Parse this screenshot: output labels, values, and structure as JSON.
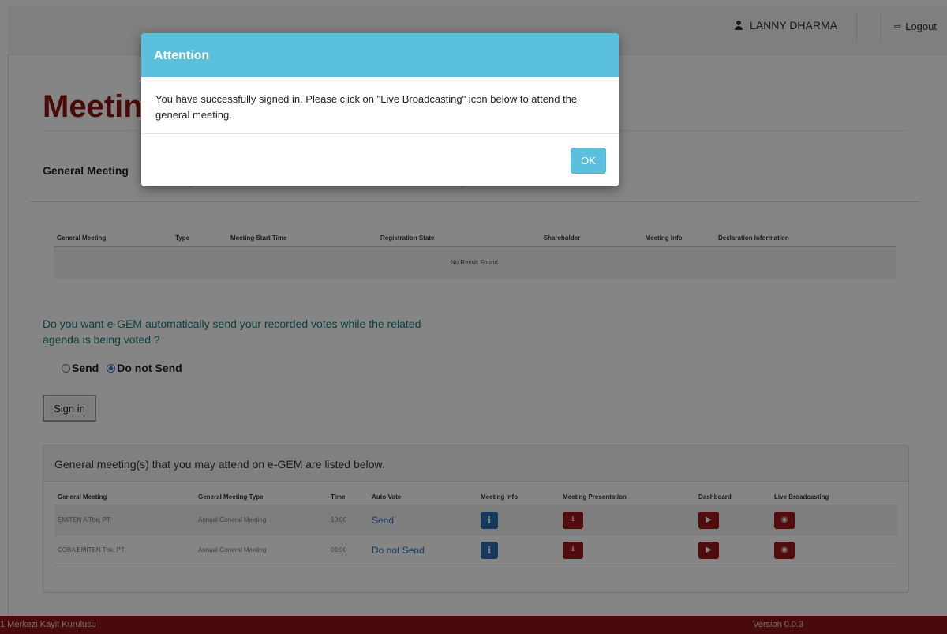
{
  "header": {
    "user_name": "LANNY DHARMA",
    "logout_label": "Logout"
  },
  "page": {
    "title": "Meeting",
    "general_meeting_label": "General Meeting"
  },
  "meetings_table": {
    "columns": [
      "General Meeting",
      "Type",
      "Meeting Start Time",
      "Registration State",
      "Shareholder",
      "Meeting Info",
      "Declaration Information"
    ],
    "empty_text": "No Result Found."
  },
  "auto_vote": {
    "question": "Do you want e-GEM automatically send your recorded votes while the related agenda is being voted ?",
    "options": [
      "Send",
      "Do not Send"
    ],
    "selected": "Do not Send",
    "signin_label": "Sign in"
  },
  "attend_panel": {
    "heading": "General meeting(s) that you may attend on e-GEM are listed below.",
    "columns": [
      "General Meeting",
      "General Meeting Type",
      "Time",
      "Auto Vote",
      "Meeting Info",
      "Meeting Presentation",
      "Dashboard",
      "Live Broadcasting"
    ],
    "rows": [
      {
        "meeting": "EMITEN A Tbk, PT",
        "type": "Annual General Meeting",
        "time": "10:00",
        "auto_vote": "Send"
      },
      {
        "meeting": "COBA EMITEN Tbk, PT",
        "type": "Annual General Meeting",
        "time": "09:00",
        "auto_vote": "Do not Send"
      }
    ]
  },
  "footer": {
    "left": "1 Merkezi Kayit Kurulusu",
    "version": "Version 0.0.3"
  },
  "modal": {
    "title": "Attention",
    "body": "You have successfully signed in. Please click on \"Live Broadcasting\" icon below to attend the general meeting.",
    "ok_label": "OK"
  },
  "colors": {
    "brand": "#8b1414",
    "info": "#5bc0de",
    "primary": "#2d6eb0"
  }
}
